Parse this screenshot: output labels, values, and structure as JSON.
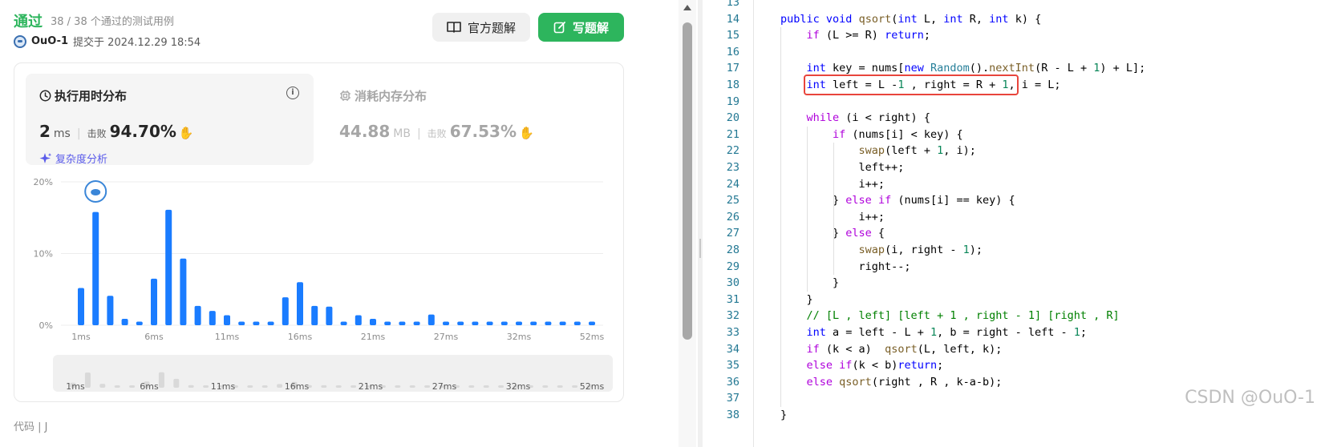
{
  "submission": {
    "status": "通过",
    "cases": "38 / 38 个通过的测试用例",
    "user": "OuO-1",
    "submitted_at": "提交于 2024.12.29 18:54"
  },
  "buttons": {
    "official": "官方题解",
    "write": "写题解"
  },
  "runtime": {
    "title": "执行用时分布",
    "value": "2",
    "unit": "ms",
    "beats_label": "击败",
    "beats": "94.70%",
    "complexity_link": "复杂度分析"
  },
  "memory": {
    "title": "消耗内存分布",
    "value": "44.88",
    "unit": "MB",
    "beats_label": "击败",
    "beats": "67.53%"
  },
  "partial_label": "代码 | J",
  "colors": {
    "accent_green": "#2db55d",
    "bar_blue": "#1a7cff",
    "highlight_red": "#e8453c"
  },
  "chart_data": {
    "type": "bar",
    "ylabels": [
      "20%",
      "10%",
      "0%"
    ],
    "ylim": [
      0,
      20
    ],
    "xlabels": [
      "1ms",
      "6ms",
      "11ms",
      "16ms",
      "21ms",
      "27ms",
      "32ms",
      "52ms"
    ],
    "values": [
      5.2,
      15.8,
      4.1,
      0.9,
      0.5,
      6.5,
      16.1,
      9.3,
      2.7,
      2.0,
      1.4,
      0.5,
      0.5,
      0.5,
      3.9,
      6.0,
      2.7,
      2.6,
      0.5,
      1.4,
      0.9,
      0.5,
      0.5,
      0.5,
      1.5,
      0.5,
      0.5,
      0.5,
      0.5,
      0.5,
      0.5,
      0.5,
      0.5,
      0.5,
      0.5,
      0.5
    ],
    "user_bar_index": 1,
    "overview_xlabels": [
      "1ms",
      "6ms",
      "11ms",
      "16ms",
      "21ms",
      "27ms",
      "32ms",
      "52ms"
    ]
  },
  "code": {
    "lines": [
      {
        "n": "13",
        "t": ""
      },
      {
        "n": "14",
        "t": "public void qsort(int L, int R, int k) {"
      },
      {
        "n": "15",
        "t": "    if (L >= R) return;"
      },
      {
        "n": "16",
        "t": ""
      },
      {
        "n": "17",
        "t": "    int key = nums[new Random().nextInt(R - L + 1) + L];"
      },
      {
        "n": "18",
        "t": "    int left = L -1 , right = R + 1, i = L;"
      },
      {
        "n": "19",
        "t": ""
      },
      {
        "n": "20",
        "t": "    while (i < right) {"
      },
      {
        "n": "21",
        "t": "        if (nums[i] < key) {"
      },
      {
        "n": "22",
        "t": "            swap(left + 1, i);"
      },
      {
        "n": "23",
        "t": "            left++;"
      },
      {
        "n": "24",
        "t": "            i++;"
      },
      {
        "n": "25",
        "t": "        } else if (nums[i] == key) {"
      },
      {
        "n": "26",
        "t": "            i++;"
      },
      {
        "n": "27",
        "t": "        } else {"
      },
      {
        "n": "28",
        "t": "            swap(i, right - 1);"
      },
      {
        "n": "29",
        "t": "            right--;"
      },
      {
        "n": "30",
        "t": "        }"
      },
      {
        "n": "31",
        "t": "    }"
      },
      {
        "n": "32",
        "t": "    // [L , left] [left + 1 , right - 1] [right , R]"
      },
      {
        "n": "33",
        "t": "    int a = left - L + 1, b = right - left - 1;"
      },
      {
        "n": "34",
        "t": "    if (k < a)  qsort(L, left, k);"
      },
      {
        "n": "35",
        "t": "    else if(k < b)return;"
      },
      {
        "n": "36",
        "t": "    else qsort(right , R , k-a-b);"
      },
      {
        "n": "37",
        "t": ""
      },
      {
        "n": "38",
        "t": "}"
      }
    ]
  },
  "watermark": "CSDN @OuO-1"
}
